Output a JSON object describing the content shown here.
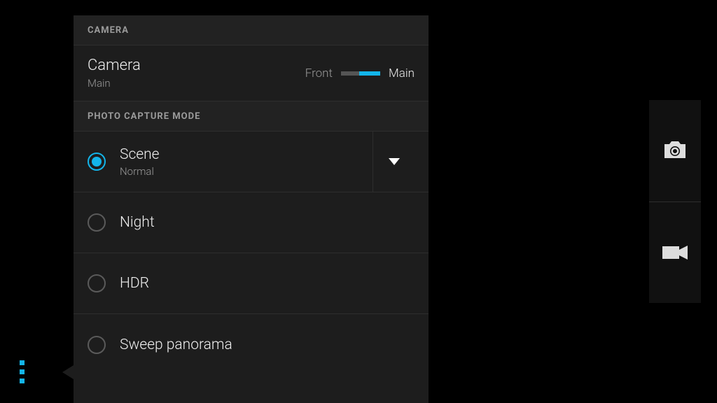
{
  "header_camera": "CAMERA",
  "camera_row": {
    "title": "Camera",
    "value": "Main",
    "option_left": "Front",
    "option_right": "Main"
  },
  "header_mode": "PHOTO CAPTURE MODE",
  "modes": [
    {
      "label": "Scene",
      "sub": "Normal",
      "selected": true,
      "expandable": true
    },
    {
      "label": "Night",
      "selected": false
    },
    {
      "label": "HDR",
      "selected": false
    },
    {
      "label": "Sweep panorama",
      "selected": false
    }
  ]
}
